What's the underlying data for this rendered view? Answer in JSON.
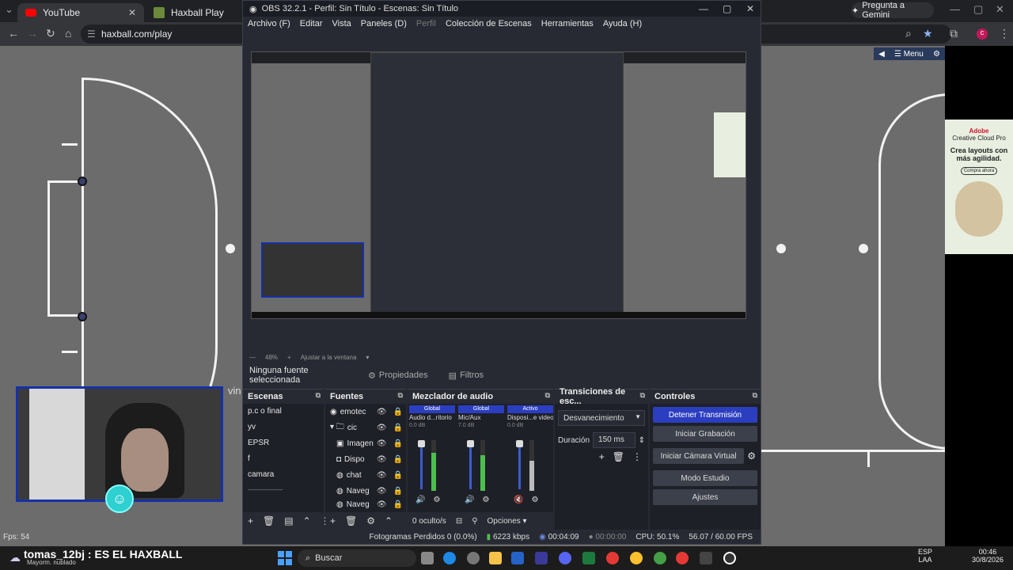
{
  "browser": {
    "tabs": [
      {
        "label": "YouTube"
      },
      {
        "label": "Haxball Play"
      }
    ],
    "gemini_label": "Pregunta a Gemini",
    "url": "haxball.com/play",
    "profile_initial": "c"
  },
  "game": {
    "fps": "Fps: 54",
    "menu_label": "Menu",
    "player_name": "tomas_12bj : ES EL HAXBALL",
    "weather": "Mayorm. nublado",
    "partial_text": "vin",
    "ad": {
      "brand": "Adobe",
      "product": "Creative Cloud Pro",
      "headline": "Crea layouts con más agilidad.",
      "cta": "Compra ahora"
    }
  },
  "obs": {
    "title": "OBS 32.2.1 - Perfil: Sin Título - Escenas: Sin Título",
    "menu": [
      "Archivo (F)",
      "Editar",
      "Vista",
      "Paneles (D)",
      "Perfil",
      "Colección de Escenas",
      "Herramientas",
      "Ayuda (H)"
    ],
    "zoom": "48%",
    "fit_label": "Ajustar a la ventana",
    "selection": {
      "none": "Ninguna fuente seleccionada",
      "properties": "Propiedades",
      "filters": "Filtros"
    },
    "scenes": {
      "title": "Escenas",
      "items": [
        "p.c o final",
        "yv",
        "EPSR",
        "f",
        "camara",
        "-------------------"
      ]
    },
    "sources": {
      "title": "Fuentes",
      "items": [
        "emotec",
        "cic",
        "Imagen",
        "Dispo",
        "chat",
        "Naveg",
        "Naveg"
      ]
    },
    "mixer": {
      "title": "Mezclador de audio",
      "channels": [
        {
          "tag": "Global",
          "name": "Audio d...ritorio",
          "db": "0.0 dB",
          "level": 0.75
        },
        {
          "tag": "Global",
          "name": "Mic/Aux",
          "db": "7.0 dB",
          "level": 0.7
        },
        {
          "tag": "Activo",
          "name": "Disposi...e video",
          "db": "0.0 dB",
          "level": 0.6
        }
      ],
      "hidden": "0 oculto/s",
      "options": "Opciones"
    },
    "transitions": {
      "title": "Transiciones de esc...",
      "selected": "Desvanecimiento",
      "duration_label": "Duración",
      "duration_value": "150 ms"
    },
    "controls": {
      "title": "Controles",
      "buttons": [
        "Detener Transmisión",
        "Iniciar Grabación",
        "Iniciar Cámara Virtual",
        "Modo Estudio",
        "Ajustes"
      ]
    },
    "status": {
      "dropped": "Fotogramas Perdidos 0 (0.0%)",
      "bitrate": "6223 kbps",
      "stream_time": "00:04:09",
      "rec_time": "00:00:00",
      "cpu": "CPU: 50.1%",
      "fps": "56.07 / 60.00 FPS"
    }
  },
  "taskbar": {
    "search": "Buscar",
    "lang": "ESP",
    "layout": "LAA",
    "time": "00:46",
    "date": "30/8/2026"
  },
  "colors": {
    "accent": "#2b3ec0",
    "field": "#6c6c6c",
    "obs_bg": "#272a33"
  }
}
